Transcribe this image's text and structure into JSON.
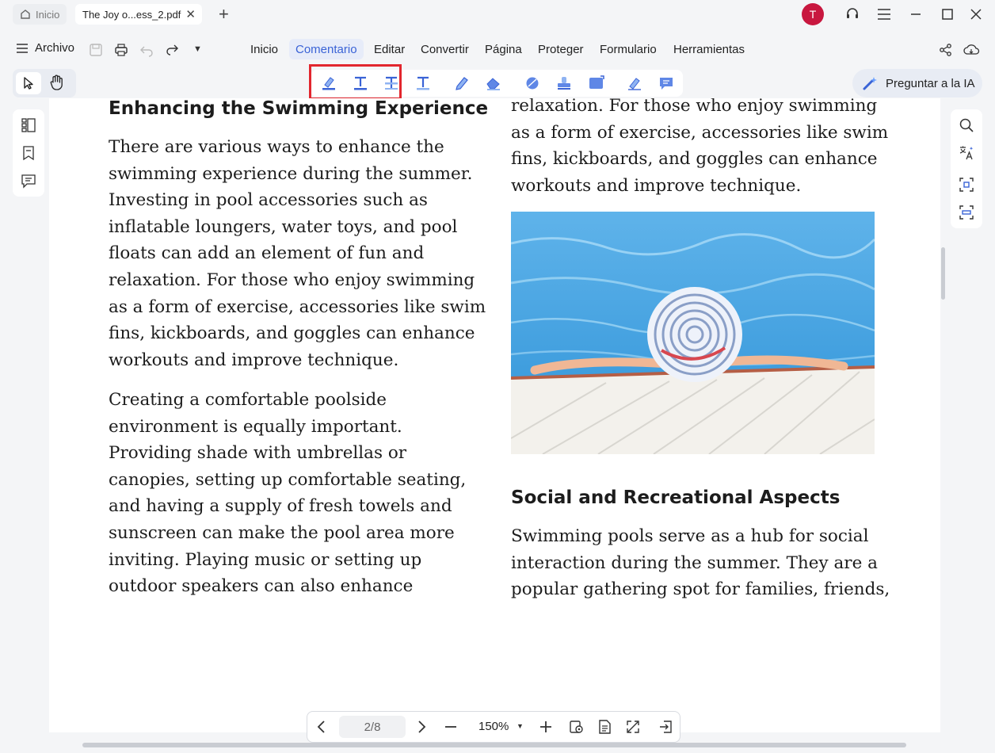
{
  "tabs": {
    "home_label": "Inicio",
    "doc_label": "The Joy o...ess_2.pdf"
  },
  "user": {
    "avatar_letter": "T",
    "avatar_color": "#c8173f"
  },
  "menu": {
    "archivo": "Archivo",
    "items": [
      "Inicio",
      "Comentario",
      "Editar",
      "Convertir",
      "Página",
      "Proteger",
      "Formulario",
      "Herramientas"
    ],
    "active": "Comentario"
  },
  "toolbar": {
    "tools": [
      "highlight-icon",
      "underline-icon",
      "strikethrough-icon",
      "text-icon",
      "pencil-icon",
      "eraser-icon",
      "shape-icon",
      "stamp-icon",
      "attachment-icon",
      "sign-icon",
      "note-icon"
    ],
    "ask_ai_label": "Preguntar a la IA"
  },
  "document": {
    "left_heading": "Enhancing the Swimming Experience",
    "left_para1": "There are various ways to enhance the swimming experience during the summer. Investing in pool accessories such as inflatable loungers, water toys, and pool floats can add an element of fun and relaxation. For those who enjoy swimming as a form of exercise, accessories like swim fins, kickboards, and goggles can enhance workouts and improve technique.",
    "left_para2": "Creating a comfortable poolside environment is equally important. Providing shade with umbrellas or canopies, setting up comfortable seating, and having a supply of fresh towels and sunscreen can make the pool area more inviting. Playing music or setting up outdoor speakers can also enhance",
    "right_top_text": "relaxation. For those who enjoy swimming as a form of exercise, accessories like swim fins, kickboards, and goggles can enhance workouts and improve technique.",
    "right_heading": "Social and Recreational Aspects",
    "right_para": "Swimming pools serve as a hub for social interaction during the summer. They are a popular gathering spot for families, friends,"
  },
  "navigation": {
    "page_indicator": "2/8",
    "zoom": "150%"
  },
  "colors": {
    "accent": "#3a63d6",
    "annotation_red": "#e2262e"
  }
}
